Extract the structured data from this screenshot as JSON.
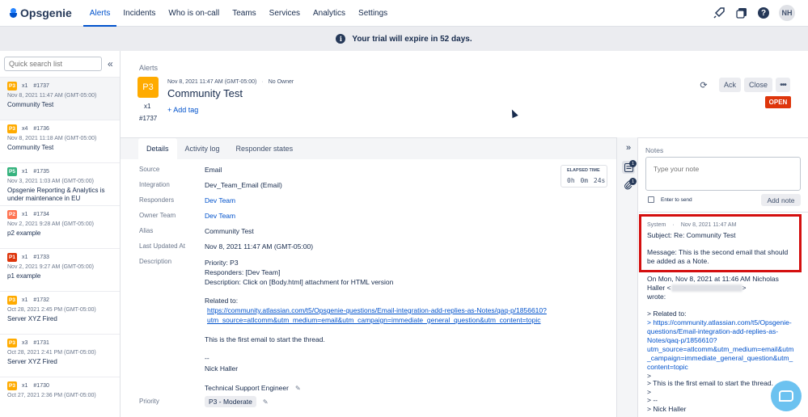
{
  "nav": {
    "logo": "Opsgenie",
    "items": [
      "Alerts",
      "Incidents",
      "Who is on-call",
      "Teams",
      "Services",
      "Analytics",
      "Settings"
    ],
    "avatar": "NH",
    "icons": [
      "rocket-icon",
      "integrations-icon",
      "help-icon"
    ]
  },
  "banner": {
    "text": "Your trial will expire in 52 days."
  },
  "sidebar": {
    "search_placeholder": "Quick search list",
    "alerts": [
      {
        "priority": "P3",
        "pcolor": "#ffab00",
        "count": "x1",
        "id": "#1737",
        "date": "Nov 8, 2021 11:47 AM (GMT-05:00)",
        "title": "Community Test"
      },
      {
        "priority": "P3",
        "pcolor": "#ffab00",
        "count": "x4",
        "id": "#1736",
        "date": "Nov 8, 2021 11:18 AM (GMT-05:00)",
        "title": "Community Test"
      },
      {
        "priority": "P5",
        "pcolor": "#36b37e",
        "count": "x1",
        "id": "#1735",
        "date": "Nov 3, 2021 1:03 AM (GMT-05:00)",
        "title": "Opsgenie Reporting & Analytics is under maintenance in EU"
      },
      {
        "priority": "P2",
        "pcolor": "#ff7452",
        "count": "x1",
        "id": "#1734",
        "date": "Nov 2, 2021 9:28 AM (GMT-05:00)",
        "title": "p2 example"
      },
      {
        "priority": "P1",
        "pcolor": "#de350b",
        "count": "x1",
        "id": "#1733",
        "date": "Nov 2, 2021 9:27 AM (GMT-05:00)",
        "title": "p1 example"
      },
      {
        "priority": "P3",
        "pcolor": "#ffab00",
        "count": "x1",
        "id": "#1732",
        "date": "Oct 28, 2021 2:45 PM (GMT-05:00)",
        "title": "Server XYZ Fired"
      },
      {
        "priority": "P3",
        "pcolor": "#ffab00",
        "count": "x3",
        "id": "#1731",
        "date": "Oct 28, 2021 2:41 PM (GMT-05:00)",
        "title": "Server XYZ Fired"
      },
      {
        "priority": "P3",
        "pcolor": "#ffab00",
        "count": "x1",
        "id": "#1730",
        "date": "Oct 27, 2021 2:36 PM (GMT-05:00)",
        "title": ""
      }
    ]
  },
  "alert": {
    "breadcrumb": "Alerts",
    "priority": "P3",
    "count": "x1",
    "id": "#1737",
    "created": "Nov 8, 2021 11:47 AM (GMT-05:00)",
    "owner": "No Owner",
    "title": "Community Test",
    "add_tag": "+ Add tag",
    "ack_label": "Ack",
    "close_label": "Close",
    "status": "OPEN"
  },
  "tabs": [
    "Details",
    "Activity log",
    "Responder states"
  ],
  "details": {
    "labels": {
      "source": "Source",
      "integration": "Integration",
      "responders": "Responders",
      "owner_team": "Owner Team",
      "alias": "Alias",
      "last_updated": "Last Updated At",
      "description": "Description",
      "priority": "Priority"
    },
    "values": {
      "source": "Email",
      "integration": "Dev_Team_Email (Email)",
      "responders": "Dev Team",
      "owner_team": "Dev Team",
      "alias": "Community Test",
      "last_updated": "Nov 8, 2021 11:47 AM (GMT-05:00)",
      "priority": "P3 - Moderate"
    },
    "description": {
      "line1": "Priority: P3",
      "line2": "Responders: [Dev Team]",
      "line3": "Description: Click on [Body.html] attachment for HTML version",
      "related": "Related to:",
      "link1": "https://community.atlassian.com/t5/Opsgenie-questions/Email-integration-add-replies-as-Notes/qaq-p/1856610?",
      "link2": "utm_source=atlcomm&utm_medium=email&utm_campaign=immediate_general_question&utm_content=topic",
      "first_email": "This is the first email to start the thread.",
      "dashes": "--",
      "name": "Nick Haller",
      "role": "Technical Support Engineer"
    },
    "elapsed": {
      "label": "ELAPSED TIME",
      "value": "0h 0m 24s"
    }
  },
  "side_tools": {
    "notes_badge": "1",
    "attach_badge": "1"
  },
  "notes": {
    "title": "Notes",
    "placeholder": "Type your note",
    "enter_to_send": "Enter to send",
    "add_note": "Add note",
    "entry": {
      "author": "System",
      "date": "Nov 8, 2021 11:47 AM",
      "subject": "Subject: Re: Community Test",
      "message1": "Message: This is the second email that should",
      "message2": "be added as a Note.",
      "on_line": "On Mon, Nov 8, 2021 at 11:46 AM Nicholas",
      "haller": "Haller <",
      "haller_end": ">",
      "wrote": "wrote:",
      "quote1": "> Related to:",
      "quote2": "> https://community.atlassian.com/t5/Opsgenie-",
      "quote3": "questions/Email-integration-add-replies-as-",
      "quote4": "Notes/qaq-p/1856610?",
      "quote5": "utm_source=atlcomm&utm_medium=email&utm",
      "quote6": "_campaign=immediate_general_question&utm_",
      "quote7": "content=topic",
      "quote8": ">",
      "quote9": "> This is the first email to start the thread.",
      "quote10": ">",
      "quote11": "> --",
      "quote12": "> Nick Haller"
    }
  },
  "colors": {
    "accent": "#0052cc",
    "open": "#de350b",
    "highlight": "#d40f0f"
  }
}
